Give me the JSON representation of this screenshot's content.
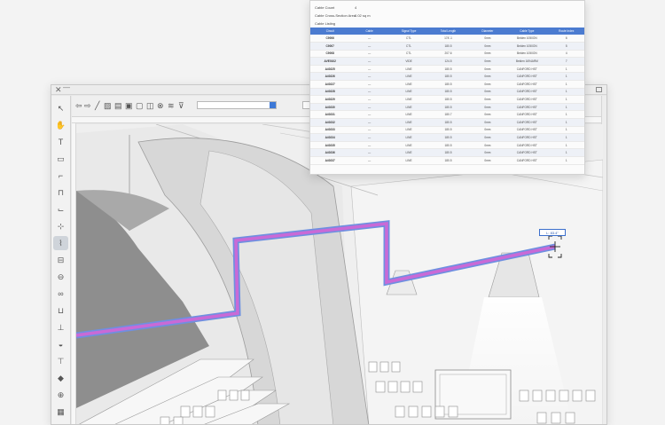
{
  "window": {
    "close_glyph": "✕",
    "minimize_glyph": "—"
  },
  "toolbar": {
    "tools": [
      {
        "name": "selection-tool-icon",
        "glyph": "↖"
      },
      {
        "name": "pan-tool-icon",
        "glyph": "✋"
      },
      {
        "name": "text-tool-icon",
        "glyph": "T"
      },
      {
        "name": "shape-tool-icon",
        "glyph": "▭"
      },
      {
        "name": "stair-tool-icon",
        "glyph": "⌐"
      },
      {
        "name": "pulse-tool-icon",
        "glyph": "⊓"
      },
      {
        "name": "hook-tool-icon",
        "glyph": "⌙"
      },
      {
        "name": "crosshair-tool-icon",
        "glyph": "⊹"
      },
      {
        "name": "cable-tool-icon",
        "glyph": "⌇",
        "active": true
      },
      {
        "name": "connector-tool-icon",
        "glyph": "⊟"
      },
      {
        "name": "coax-tool-icon",
        "glyph": "⊖"
      },
      {
        "name": "chain-tool-icon",
        "glyph": "∞"
      },
      {
        "name": "bridge-tool-icon",
        "glyph": "⊔"
      },
      {
        "name": "junction-tool-icon",
        "glyph": "⊥"
      },
      {
        "name": "speaker-tool-icon",
        "glyph": "◒"
      },
      {
        "name": "drill-tool-icon",
        "glyph": "⊤"
      },
      {
        "name": "node-tool-icon",
        "glyph": "◆"
      },
      {
        "name": "power-tool-icon",
        "glyph": "⊕"
      },
      {
        "name": "grid-tool-icon",
        "glyph": "▦"
      }
    ]
  },
  "cable_panel": {
    "cable_count_label": "Cable Count",
    "cable_count_value": "4",
    "cross_section_label": "Cable Cross-Section Area",
    "cross_section_value": "0.02 sq m",
    "listing_label": "Cable Listing",
    "columns": [
      "Circuit",
      "Cable",
      "Signal Type",
      "Total Length",
      "Diameter",
      "Cable Type",
      "Route Index"
    ],
    "rows": [
      [
        "C9006",
        "—",
        "CTL",
        "174'-1",
        "0mm",
        "Belden 1050ON",
        "6"
      ],
      [
        "C9007",
        "—",
        "CTL",
        "180.5",
        "0mm",
        "Belden 1050ON",
        "5"
      ],
      [
        "C9008",
        "—",
        "CTL",
        "207.6",
        "0mm",
        "Belden 1050ON",
        "4"
      ],
      [
        "AVE0102",
        "—",
        "VIDE",
        "124.5",
        "0mm",
        "Belden 1694ARM",
        "7"
      ],
      [
        "A40225",
        "—",
        "LINE",
        "180.5",
        "0mm",
        "CANFORD HST",
        "1"
      ],
      [
        "A40226",
        "—",
        "LINE",
        "180.5",
        "0mm",
        "CANFORD HST",
        "1"
      ],
      [
        "A40227",
        "—",
        "LINE",
        "180.5",
        "0mm",
        "CANFORD HST",
        "1"
      ],
      [
        "A40228",
        "—",
        "LINE",
        "180.5",
        "0mm",
        "CANFORD HST",
        "1"
      ],
      [
        "A40229",
        "—",
        "LINE",
        "180.5",
        "0mm",
        "CANFORD HST",
        "1"
      ],
      [
        "A40230",
        "—",
        "LINE",
        "180.5",
        "0mm",
        "CANFORD HST",
        "1"
      ],
      [
        "A40231",
        "—",
        "LINE",
        "180.7",
        "0mm",
        "CANFORD HST",
        "1"
      ],
      [
        "A40232",
        "—",
        "LINE",
        "180.5",
        "0mm",
        "CANFORD HST",
        "1"
      ],
      [
        "A40233",
        "—",
        "LINE",
        "180.5",
        "0mm",
        "CANFORD HST",
        "1"
      ],
      [
        "A40234",
        "—",
        "LINE",
        "180.5",
        "0mm",
        "CANFORD HST",
        "1"
      ],
      [
        "A40235",
        "—",
        "LINE",
        "180.5",
        "0mm",
        "CANFORD HST",
        "1"
      ],
      [
        "A40236",
        "—",
        "LINE",
        "180.5",
        "0mm",
        "CANFORD HST",
        "1"
      ],
      [
        "A40237",
        "—",
        "LINE",
        "180.5",
        "0mm",
        "CANFORD HST",
        "1"
      ]
    ]
  },
  "dimension": {
    "label": "L: 83.4\""
  },
  "colors": {
    "cable_stroke": "#c96ad6",
    "cable_outline": "#6f8fe0",
    "table_header": "#4b7bd0",
    "accent": "#3d79d7"
  }
}
